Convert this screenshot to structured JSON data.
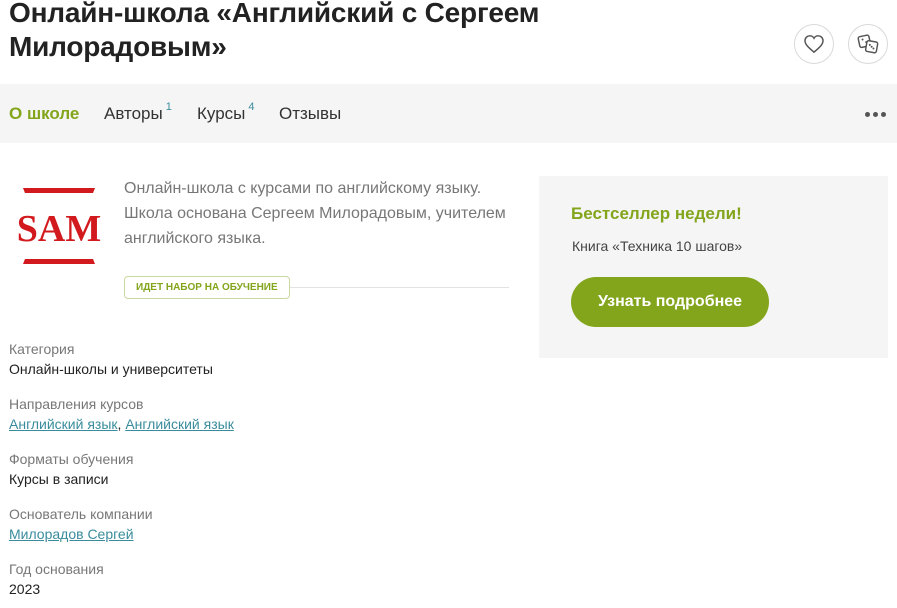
{
  "page_title": "Онлайн-школа «Английский с Сергеем Милорадовым»",
  "tabs": [
    {
      "label": "О школе",
      "count": ""
    },
    {
      "label": "Авторы",
      "count": "1"
    },
    {
      "label": "Курсы",
      "count": "4"
    },
    {
      "label": "Отзывы",
      "count": ""
    }
  ],
  "logo": {
    "text": "SAM"
  },
  "description": "Онлайн-школа с курсами по английскому языку. Школа основана Сергеем Милорадовым, учителем английского языка.",
  "enrollment_badge": "ИДЕТ НАБОР НА ОБУЧЕНИЕ",
  "info": {
    "category": {
      "label": "Категория",
      "value": "Онлайн-школы и университеты"
    },
    "directions": {
      "label": "Направления курсов",
      "links": [
        "Английский язык",
        "Английский язык"
      ],
      "separator": ","
    },
    "formats": {
      "label": "Форматы обучения",
      "value": "Курсы в записи"
    },
    "founder": {
      "label": "Основатель компании",
      "value": "Милорадов Сергей"
    },
    "founded": {
      "label": "Год основания",
      "value": "2023"
    }
  },
  "promo": {
    "title": "Бестселлер недели!",
    "text": "Книга «Техника 10 шагов»",
    "button": "Узнать подробнее"
  },
  "colors": {
    "accent": "#83a51c",
    "link": "#3a8c9d",
    "logo_red": "#d21a1e"
  }
}
